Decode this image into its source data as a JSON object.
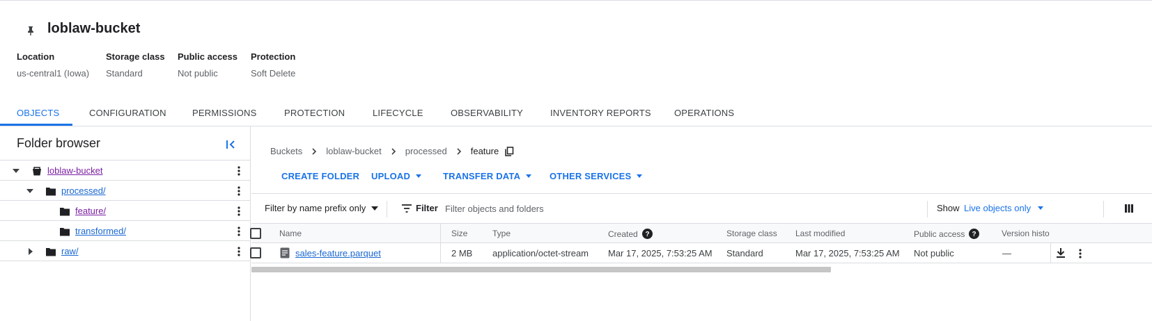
{
  "bucket": {
    "name": "loblaw-bucket",
    "pin_icon": "pin-icon",
    "meta": [
      {
        "label": "Location",
        "value": "us-central1 (Iowa)"
      },
      {
        "label": "Storage class",
        "value": "Standard"
      },
      {
        "label": "Public access",
        "value": "Not public"
      },
      {
        "label": "Protection",
        "value": "Soft Delete"
      }
    ]
  },
  "tabs": [
    "OBJECTS",
    "CONFIGURATION",
    "PERMISSIONS",
    "PROTECTION",
    "LIFECYCLE",
    "OBSERVABILITY",
    "INVENTORY REPORTS",
    "OPERATIONS"
  ],
  "active_tab": "OBJECTS",
  "folder_browser": {
    "title": "Folder browser",
    "tree": [
      {
        "label": "loblaw-bucket",
        "type": "bucket",
        "expanded": true
      },
      {
        "label": "processed/",
        "type": "folder",
        "expanded": true
      },
      {
        "label": "feature/",
        "type": "folder"
      },
      {
        "label": "transformed/",
        "type": "folder"
      },
      {
        "label": "raw/",
        "type": "folder",
        "expanded": false
      }
    ]
  },
  "breadcrumb": [
    "Buckets",
    "loblaw-bucket",
    "processed",
    "feature"
  ],
  "actions": {
    "create_folder": "CREATE FOLDER",
    "upload": "UPLOAD",
    "transfer_data": "TRANSFER DATA",
    "other_services": "OTHER SERVICES"
  },
  "filter": {
    "prefix_select": "Filter by name prefix only",
    "label": "Filter",
    "placeholder": "Filter objects and folders",
    "show_label": "Show",
    "show_value": "Live objects only"
  },
  "table": {
    "columns": [
      "Name",
      "Size",
      "Type",
      "Created",
      "Storage class",
      "Last modified",
      "Public access",
      "Version history"
    ],
    "rows": [
      {
        "name": "sales-feature.parquet",
        "size": "2 MB",
        "type": "application/octet-stream",
        "created": "Mar 17, 2025, 7:53:25 AM",
        "storage_class": "Standard",
        "last_modified": "Mar 17, 2025, 7:53:25 AM",
        "public_access": "Not public",
        "version_history": "—"
      }
    ]
  },
  "colors": {
    "accent": "#1a73e8",
    "visited_link": "#7b1fa2",
    "border": "#dadce0"
  }
}
